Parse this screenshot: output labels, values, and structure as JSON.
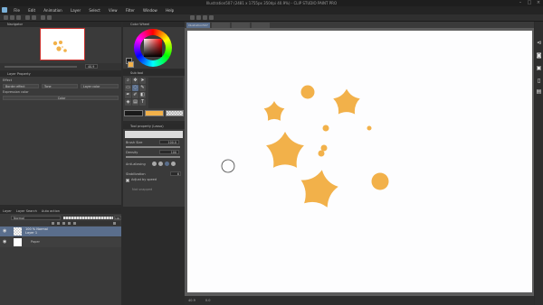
{
  "window": {
    "title": "Illustration507 (2481 x 1755px 350dpi 40.9%) - CLIP STUDIO PAINT PRO"
  },
  "menu": [
    "File",
    "Edit",
    "Animation",
    "Layer",
    "Select",
    "View",
    "Filter",
    "Window",
    "Help"
  ],
  "navigator": {
    "title": "Navigator",
    "zoom": "40.9"
  },
  "layer_property": {
    "title": "Layer Property",
    "effect_label": "Effect",
    "effects": [
      "Border effect",
      "Tone",
      "Layer color"
    ],
    "expression_label": "Expression color",
    "expression_value": "Color"
  },
  "color_wheel": {
    "title": "Color Wheel"
  },
  "sub_tool": {
    "title": "Sub tool"
  },
  "colors": {
    "main": "#1a1a1a",
    "sub": "#f2b14a",
    "accent": "#f2b14a",
    "canvas": "#fdfdfe"
  },
  "tool_property": {
    "title": "Tool property (Lasso)",
    "brush_size_label": "Brush Size",
    "brush_size_value": "100.0",
    "density_label": "Density",
    "density_value": "100",
    "anti_aliasing_label": "Anti-aliasing",
    "stabilization_label": "Stabilization",
    "stabilization_value": "6",
    "adjust_speed_label": "Adjust by speed",
    "footer_label": "Not snapped"
  },
  "layers": {
    "tabs": [
      "Layer",
      "Layer Search",
      "Auto action"
    ],
    "blend_mode": "Normal",
    "opacity": "100",
    "items": [
      {
        "name": "100 % Normal",
        "sub": "Layer 1",
        "selected": true
      },
      {
        "name": "Paper",
        "sub": "",
        "selected": false
      }
    ]
  },
  "document_tab": "Illustration507",
  "status": {
    "zoom": "40.9",
    "angle": "0.0"
  }
}
